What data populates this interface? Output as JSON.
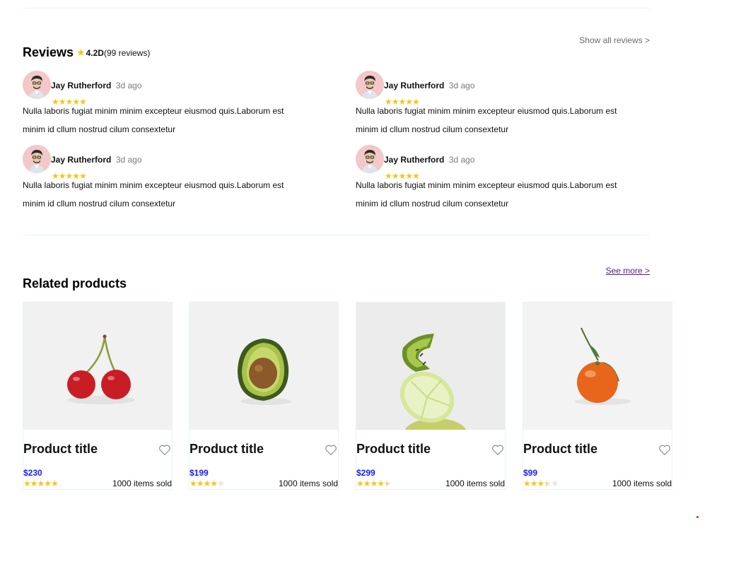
{
  "reviews": {
    "title": "Reviews",
    "rating_value": "4.2D",
    "rating_count": "(99 reviews)",
    "show_all_label": "Show all reviews >",
    "star_color": "#f5c518",
    "items": [
      {
        "name": "Jay Rutherford",
        "ago": "3d ago",
        "stars": "★★★★★",
        "text": "Nulla laboris fugiat minim minim excepteur eiusmod quis.Laborum est minim id cllum nostrud cilum consextetur"
      },
      {
        "name": "Jay Rutherford",
        "ago": "3d ago",
        "stars": "★★★★★",
        "text": "Nulla laboris fugiat minim minim excepteur eiusmod quis.Laborum est minim id cllum nostrud cilum consextetur"
      },
      {
        "name": "Jay Rutherford",
        "ago": "3d ago",
        "stars": "★★★★★",
        "text": "Nulla laboris fugiat minim minim excepteur eiusmod quis.Laborum est minim id cllum nostrud cilum consextetur"
      },
      {
        "name": "Jay Rutherford",
        "ago": "3d ago",
        "stars": "★★★★★",
        "text": "Nulla laboris fugiat minim minim excepteur eiusmod quis.Laborum est minim id cllum nostrud cilum consextetur"
      }
    ]
  },
  "related": {
    "title": "Related products",
    "see_more_label": "See more >",
    "price_color": "#1a1aff",
    "products": [
      {
        "image": "cherries",
        "title": "Product title",
        "price": "$230",
        "rating": 5,
        "sold": "1000 items sold"
      },
      {
        "image": "avocado",
        "title": "Product title",
        "price": "$199",
        "rating": 4,
        "sold": "1000 items sold"
      },
      {
        "image": "kiwi-lime-pear",
        "title": "Product title",
        "price": "$299",
        "rating": 4.5,
        "sold": "1000 items sold"
      },
      {
        "image": "tangerine",
        "title": "Product title",
        "price": "$99",
        "rating": 3.5,
        "sold": "1000 items sold"
      }
    ]
  }
}
